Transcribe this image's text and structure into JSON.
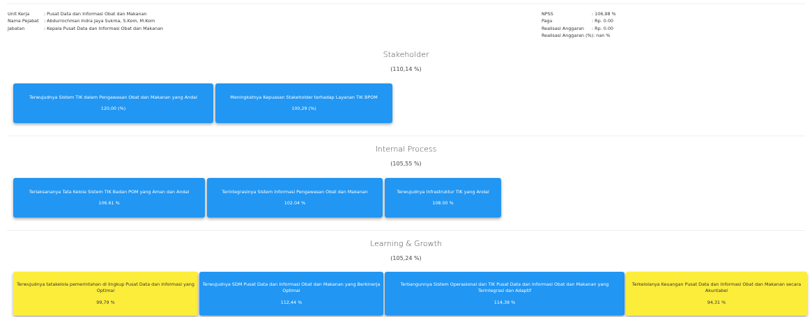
{
  "header": {
    "left": [
      {
        "key": "Unit Kerja",
        "value": ": Pusat Data dan Informasi Obat dan Makanan"
      },
      {
        "key": "Nama Pejabat",
        "value": ": Abdurrochman Indra Jaya Sukma, S.Kom, M.Kom"
      },
      {
        "key": "Jabatan",
        "value": ": Kepala Pusat Data dan Informasi Obat dan Makanan"
      }
    ],
    "right": [
      {
        "key": "NPSS",
        "value": ": 106,98 %"
      },
      {
        "key": "Pagu",
        "value": ": Rp. 0.00"
      },
      {
        "key": "Realisasi Anggaran",
        "value": ": Rp. 0.00"
      },
      {
        "key": "Realisasi Anggaran (%)",
        "value": ": nan %"
      }
    ]
  },
  "sections": [
    {
      "title": "Stakeholder",
      "score": "(110,14 %)",
      "cards": [
        {
          "label": "Terwujudnya Sistem TIK dalam Pengawasan Obat dan Makanan yang Andal",
          "value": "120,00 (%)",
          "color": "#2196f3"
        },
        {
          "label": "Meningkatnya Kepuasan Stakeholder terhadap Layanan TIK BPOM",
          "value": "100,29 (%)",
          "color": "#2196f3"
        }
      ]
    },
    {
      "title": "Internal Process",
      "score": "(105,55 %)",
      "cards": [
        {
          "label": "Terlaksananya Tata Kelola Sistem TIK Badan POM yang Aman dan Andal",
          "value": "106.61 %",
          "color": "#2196f3"
        },
        {
          "label": "Terintegrasinya Sistem Informasi Pengawasan Obat dan Makanan",
          "value": "102.04 %",
          "color": "#2196f3"
        },
        {
          "label": "Terwujudnya Infrastruktur TIK yang Andal",
          "value": "108.00 %",
          "color": "#2196f3"
        }
      ]
    },
    {
      "title": "Learning & Growth",
      "score": "(105,24 %)",
      "cards": [
        {
          "label": "Terwujudnya tatakelola pemerintahan di lingkup Pusat Data dan Informasi yang Optimal",
          "value": "99,79 %",
          "color": "#fced3b"
        },
        {
          "label": "Terwujudnya SDM Pusat Data dan Informasi Obat dan Makanan yang Berkinerja Optimal",
          "value": "112,44 %",
          "color": "#2196f3"
        },
        {
          "label": "Terbangunnya Sistem Operasional dan TIK Pusat Data dan Informasi Obat dan Makanan yang Terintegrasi dan Adaptif",
          "value": "114,39 %",
          "color": "#2196f3"
        },
        {
          "label": "Terkelolanya Keuangan Pusat Data dan Informasi Obat dan Makanan secara Akuntabel",
          "value": "94,31 %",
          "color": "#fced3b"
        }
      ]
    }
  ]
}
